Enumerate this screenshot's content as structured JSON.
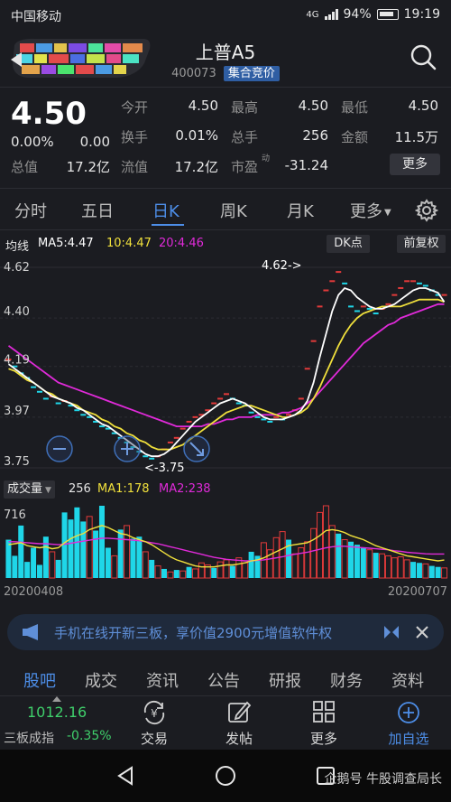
{
  "status": {
    "carrier": "中国移动",
    "network": "4G",
    "battery": "94%",
    "time": "19:19"
  },
  "header": {
    "title": "上普A5",
    "code": "400073",
    "badge": "集合竞价"
  },
  "quote": {
    "price": "4.50",
    "change_pct": "0.00%",
    "change": "0.00",
    "fields": [
      {
        "label": "今开",
        "value": "4.50"
      },
      {
        "label": "最高",
        "value": "4.50"
      },
      {
        "label": "最低",
        "value": "4.50"
      },
      {
        "label": "换手",
        "value": "0.01%"
      },
      {
        "label": "总手",
        "value": "256"
      },
      {
        "label": "金额",
        "value": "11.5万"
      },
      {
        "label": "总值",
        "value": "17.2亿"
      },
      {
        "label": "流值",
        "value": "17.2亿"
      },
      {
        "label": "市盈",
        "value": "-31.24",
        "sup": "动"
      }
    ],
    "more_label": "更多"
  },
  "tabs": [
    "分时",
    "五日",
    "日K",
    "周K",
    "月K",
    "更多"
  ],
  "active_tab": "日K",
  "ma": {
    "label": "均线",
    "ma5": "MA5:4.47",
    "ma10": "10:4.47",
    "ma20": "20:4.46",
    "dk_btn": "DK点",
    "fq_btn": "前复权"
  },
  "colors": {
    "up": "#e23a3a",
    "down": "#1fd6e8",
    "ma5": "#ffffff",
    "ma10": "#f0e03c",
    "ma20": "#e02ad9",
    "accent": "#4d8ee8"
  },
  "chart_data": {
    "type": "bar",
    "title": "",
    "price_axis": [
      "4.62",
      "4.40",
      "4.19",
      "3.97",
      "3.75"
    ],
    "ylim": [
      3.75,
      4.62
    ],
    "annotations": {
      "high": "4.62->",
      "low": "<-3.75"
    },
    "close": [
      4.22,
      4.19,
      4.16,
      4.14,
      4.1,
      4.08,
      4.05,
      4.06,
      4.03,
      4.04,
      4.02,
      4.0,
      3.98,
      3.97,
      3.95,
      3.93,
      3.92,
      3.9,
      3.88,
      3.86,
      3.84,
      3.82,
      3.8,
      3.79,
      3.8,
      3.83,
      3.86,
      3.88,
      3.92,
      3.95,
      3.97,
      3.98,
      4.0,
      4.03,
      4.05,
      4.07,
      4.05,
      4.03,
      4.02,
      3.99,
      3.97,
      3.96,
      3.95,
      3.97,
      3.96,
      3.98,
      4.0,
      4.05,
      4.18,
      4.3,
      4.45,
      4.52,
      4.56,
      4.6,
      4.55,
      4.45,
      4.43,
      4.45,
      4.44,
      4.42,
      4.44,
      4.46,
      4.5,
      4.53,
      4.56,
      4.56,
      4.55,
      4.54,
      4.52,
      4.5,
      4.5
    ],
    "ma5": [
      4.2,
      4.18,
      4.16,
      4.14,
      4.12,
      4.1,
      4.08,
      4.06,
      4.05,
      4.04,
      4.03,
      4.01,
      4.0,
      3.98,
      3.96,
      3.94,
      3.93,
      3.91,
      3.89,
      3.87,
      3.85,
      3.83,
      3.81,
      3.8,
      3.8,
      3.81,
      3.83,
      3.86,
      3.89,
      3.92,
      3.95,
      3.97,
      3.99,
      4.01,
      4.03,
      4.04,
      4.05,
      4.04,
      4.03,
      4.01,
      3.99,
      3.97,
      3.96,
      3.96,
      3.96,
      3.97,
      3.98,
      4.0,
      4.04,
      4.12,
      4.23,
      4.33,
      4.43,
      4.5,
      4.53,
      4.52,
      4.49,
      4.47,
      4.45,
      4.44,
      4.44,
      4.45,
      4.46,
      4.48,
      4.5,
      4.52,
      4.53,
      4.53,
      4.52,
      4.51,
      4.47
    ],
    "ma10": [
      4.18,
      4.17,
      4.15,
      4.13,
      4.12,
      4.1,
      4.08,
      4.07,
      4.05,
      4.04,
      4.03,
      4.02,
      4.0,
      3.99,
      3.98,
      3.96,
      3.95,
      3.93,
      3.92,
      3.9,
      3.89,
      3.87,
      3.86,
      3.84,
      3.83,
      3.83,
      3.83,
      3.84,
      3.85,
      3.87,
      3.89,
      3.91,
      3.93,
      3.95,
      3.97,
      3.99,
      4.0,
      4.01,
      4.02,
      4.02,
      4.01,
      4.0,
      3.99,
      3.98,
      3.97,
      3.97,
      3.98,
      3.99,
      4.01,
      4.05,
      4.1,
      4.16,
      4.22,
      4.28,
      4.33,
      4.37,
      4.4,
      4.42,
      4.43,
      4.44,
      4.45,
      4.45,
      4.45,
      4.45,
      4.46,
      4.47,
      4.48,
      4.48,
      4.48,
      4.48,
      4.47
    ],
    "ma20": [
      4.28,
      4.26,
      4.24,
      4.22,
      4.2,
      4.18,
      4.16,
      4.14,
      4.12,
      4.11,
      4.1,
      4.09,
      4.08,
      4.07,
      4.06,
      4.05,
      4.04,
      4.03,
      4.02,
      4.01,
      4.0,
      3.99,
      3.98,
      3.97,
      3.96,
      3.95,
      3.94,
      3.93,
      3.93,
      3.93,
      3.93,
      3.93,
      3.94,
      3.94,
      3.95,
      3.96,
      3.96,
      3.97,
      3.97,
      3.97,
      3.98,
      3.98,
      3.98,
      3.98,
      3.99,
      3.99,
      4.0,
      4.01,
      4.03,
      4.05,
      4.08,
      4.11,
      4.14,
      4.17,
      4.2,
      4.23,
      4.26,
      4.29,
      4.31,
      4.33,
      4.35,
      4.37,
      4.38,
      4.4,
      4.41,
      4.42,
      4.43,
      4.44,
      4.45,
      4.46,
      4.46
    ],
    "volume_label": "成交量",
    "volume_summary": {
      "vol": "256",
      "ma1": "MA1:178",
      "ma2": "MA2:238"
    },
    "volume_axis_max": "716",
    "volume": [
      380,
      220,
      520,
      160,
      300,
      130,
      410,
      260,
      180,
      650,
      580,
      700,
      560,
      610,
      470,
      740,
      300,
      220,
      480,
      520,
      390,
      410,
      260,
      180,
      120,
      90,
      60,
      80,
      70,
      110,
      90,
      150,
      130,
      100,
      160,
      180,
      120,
      200,
      150,
      260,
      220,
      350,
      280,
      400,
      460,
      380,
      240,
      300,
      360,
      490,
      650,
      720,
      520,
      440,
      380,
      360,
      330,
      300,
      280,
      250,
      240,
      220,
      200,
      210,
      180,
      160,
      150,
      140,
      120,
      110,
      100
    ],
    "volume_up": [
      false,
      false,
      false,
      false,
      false,
      false,
      false,
      true,
      false,
      false,
      false,
      false,
      false,
      true,
      false,
      false,
      false,
      true,
      false,
      true,
      false,
      false,
      true,
      false,
      true,
      false,
      true,
      false,
      true,
      false,
      true,
      true,
      true,
      false,
      true,
      true,
      false,
      true,
      true,
      false,
      false,
      true,
      true,
      true,
      true,
      false,
      true,
      true,
      true,
      true,
      true,
      true,
      true,
      false,
      true,
      false,
      false,
      false,
      true,
      false,
      true,
      true,
      true,
      true,
      true,
      false,
      false,
      true,
      false,
      false,
      true
    ],
    "vol_ma1": [
      330,
      340,
      350,
      320,
      310,
      300,
      310,
      290,
      300,
      350,
      390,
      420,
      440,
      480,
      500,
      520,
      500,
      470,
      440,
      430,
      400,
      380,
      360,
      330,
      290,
      250,
      210,
      180,
      160,
      140,
      120,
      110,
      110,
      110,
      120,
      130,
      130,
      140,
      150,
      170,
      180,
      200,
      230,
      260,
      290,
      320,
      330,
      340,
      350,
      380,
      420,
      470,
      480,
      470,
      450,
      420,
      400,
      380,
      350,
      320,
      300,
      280,
      260,
      240,
      220,
      210,
      200,
      190,
      180,
      170,
      178
    ],
    "vol_ma2": [
      360,
      360,
      355,
      350,
      345,
      340,
      340,
      335,
      330,
      335,
      345,
      355,
      365,
      375,
      385,
      395,
      395,
      390,
      385,
      380,
      375,
      370,
      360,
      350,
      340,
      325,
      310,
      295,
      280,
      265,
      250,
      235,
      220,
      205,
      195,
      185,
      180,
      175,
      170,
      170,
      175,
      180,
      190,
      200,
      210,
      225,
      235,
      245,
      255,
      270,
      285,
      300,
      310,
      315,
      315,
      310,
      305,
      300,
      295,
      290,
      285,
      280,
      270,
      265,
      255,
      250,
      245,
      240,
      238,
      238,
      238
    ],
    "dates": {
      "start": "20200408",
      "end": "20200707"
    }
  },
  "banner": {
    "text": "手机在线开新三板，享价值2900元增值软件权"
  },
  "bottom_tabs": [
    "股吧",
    "成交",
    "资讯",
    "公告",
    "研报",
    "财务",
    "资料"
  ],
  "bottom_bar": {
    "index_value": "1012.16",
    "index_name": "三板成指",
    "index_change": "-0.35%",
    "buttons": [
      "交易",
      "发帖",
      "更多",
      "加自选"
    ]
  },
  "watermark": "企鹅号 牛股调查局长"
}
